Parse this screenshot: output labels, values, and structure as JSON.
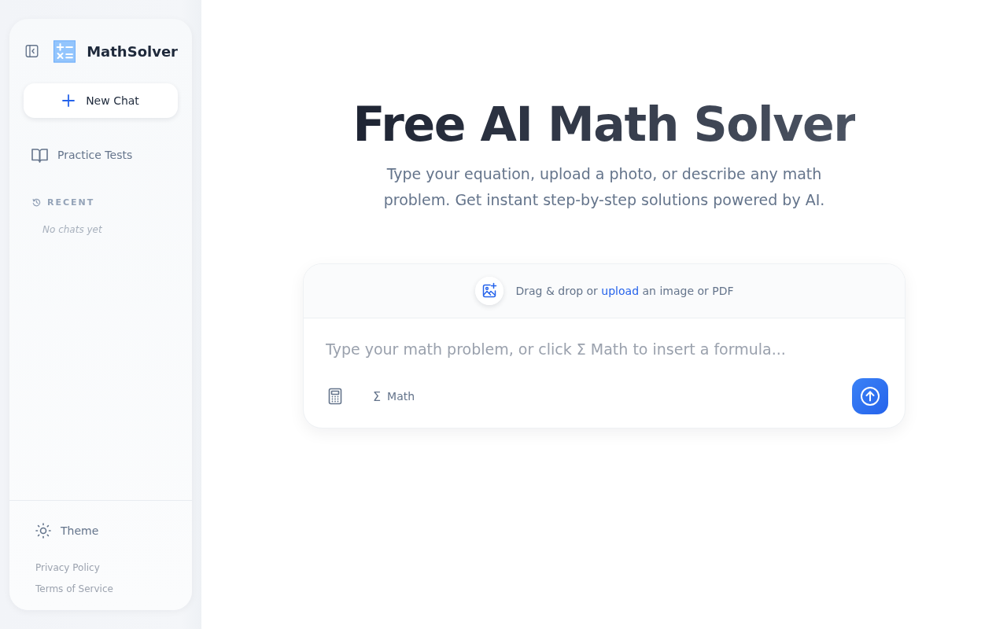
{
  "sidebar": {
    "brand": "MathSolver",
    "new_chat": "New Chat",
    "practice_tests": "Practice Tests",
    "recent": {
      "heading": "RECENT",
      "empty": "No chats yet"
    },
    "footer": {
      "theme": "Theme",
      "links": [
        "Privacy Policy",
        "Terms of Service"
      ]
    }
  },
  "hero": {
    "title": "Free AI Math Solver",
    "subtitle": "Type your equation, upload a photo, or describe any math problem. Get instant step-by-step solutions powered by AI."
  },
  "composer": {
    "dropzone": {
      "before": "Drag & drop or",
      "link": "upload",
      "after": "an image or PDF"
    },
    "placeholder": "Type your math problem, or click Σ Math to insert a formula...",
    "math_button": {
      "symbol": "Σ",
      "label": "Math"
    }
  }
}
